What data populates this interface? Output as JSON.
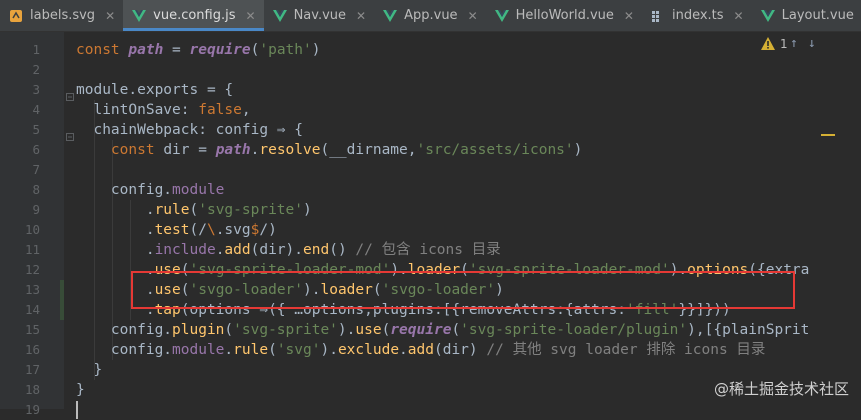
{
  "tabs": [
    {
      "label": "labels.svg",
      "icon": "svg-file-icon",
      "active": false
    },
    {
      "label": "vue.config.js",
      "icon": "vue-file-icon",
      "active": true
    },
    {
      "label": "Nav.vue",
      "icon": "vue-file-icon",
      "active": false
    },
    {
      "label": "App.vue",
      "icon": "vue-file-icon",
      "active": false
    },
    {
      "label": "HelloWorld.vue",
      "icon": "vue-file-icon",
      "active": false
    },
    {
      "label": "index.ts",
      "icon": "typescript-file-icon",
      "active": false
    },
    {
      "label": "Layout.vue",
      "icon": "vue-file-icon",
      "active": false
    }
  ],
  "overflow_icon": "nodejs-icon",
  "inspection": {
    "warning_count": "1",
    "up": "↑",
    "down": "↓"
  },
  "line_numbers": [
    "1",
    "2",
    "3",
    "4",
    "5",
    "6",
    "7",
    "8",
    "9",
    "10",
    "11",
    "12",
    "13",
    "14",
    "15",
    "16",
    "17",
    "18",
    "19"
  ],
  "code_lines": [
    [
      [
        "k",
        "const "
      ],
      [
        "v",
        "path"
      ],
      [
        "d",
        " = "
      ],
      [
        "v",
        "require"
      ],
      [
        "d",
        "("
      ],
      [
        "s",
        "'path'"
      ],
      [
        "d",
        ")"
      ]
    ],
    [],
    [
      [
        "d",
        "module.exports = {"
      ]
    ],
    [
      [
        "d",
        "  lintOnSave: "
      ],
      [
        "k",
        "false"
      ],
      [
        "d",
        ","
      ]
    ],
    [
      [
        "d",
        "  chainWebpack: config ⇒ {"
      ]
    ],
    [
      [
        "k",
        "    const "
      ],
      [
        "d",
        "dir = "
      ],
      [
        "v",
        "path"
      ],
      [
        "d",
        "."
      ],
      [
        "f",
        "resolve"
      ],
      [
        "d",
        "(__dirname,"
      ],
      [
        "s",
        "'src/assets/icons'"
      ],
      [
        "d",
        ")"
      ]
    ],
    [],
    [
      [
        "d",
        "    config."
      ],
      [
        "p",
        "module"
      ]
    ],
    [
      [
        "d",
        "        ."
      ],
      [
        "f",
        "rule"
      ],
      [
        "d",
        "("
      ],
      [
        "s",
        "'svg-sprite'"
      ],
      [
        "d",
        ")"
      ]
    ],
    [
      [
        "d",
        "        ."
      ],
      [
        "f",
        "test"
      ],
      [
        "d",
        "(/"
      ],
      [
        "k",
        "\\"
      ],
      [
        "d",
        ".svg"
      ],
      [
        "k",
        "$"
      ],
      [
        "d",
        "/)"
      ]
    ],
    [
      [
        "d",
        "        ."
      ],
      [
        "p",
        "include"
      ],
      [
        "d",
        "."
      ],
      [
        "f",
        "add"
      ],
      [
        "d",
        "(dir)."
      ],
      [
        "f",
        "end"
      ],
      [
        "d",
        "() "
      ],
      [
        "c",
        "// 包含 icons 目录"
      ]
    ],
    [
      [
        "d",
        "        ."
      ],
      [
        "f",
        "use"
      ],
      [
        "d",
        "("
      ],
      [
        "s",
        "'svg-sprite-loader-mod'"
      ],
      [
        "d",
        ")."
      ],
      [
        "f",
        "loader"
      ],
      [
        "d",
        "("
      ],
      [
        "s",
        "'svg-sprite-loader-mod'"
      ],
      [
        "d",
        ")."
      ],
      [
        "f",
        "options"
      ],
      [
        "d",
        "({extra"
      ]
    ],
    [
      [
        "d",
        "        ."
      ],
      [
        "f",
        "use"
      ],
      [
        "d",
        "("
      ],
      [
        "s",
        "'svgo-loader'"
      ],
      [
        "d",
        ")."
      ],
      [
        "f",
        "loader"
      ],
      [
        "d",
        "("
      ],
      [
        "s",
        "'svgo-loader'"
      ],
      [
        "d",
        ")"
      ]
    ],
    [
      [
        "d",
        "        ."
      ],
      [
        "f",
        "tap"
      ],
      [
        "d",
        "(options ⇒({ …options,plugins:[{removeAttrs:{attrs:"
      ],
      [
        "s",
        "'fill'"
      ],
      [
        "d",
        "}}]}))"
      ]
    ],
    [
      [
        "d",
        "    config."
      ],
      [
        "f",
        "plugin"
      ],
      [
        "d",
        "("
      ],
      [
        "s",
        "'svg-sprite'"
      ],
      [
        "d",
        ")."
      ],
      [
        "f",
        "use"
      ],
      [
        "d",
        "("
      ],
      [
        "v",
        "require"
      ],
      [
        "d",
        "("
      ],
      [
        "s",
        "'svg-sprite-loader/plugin'"
      ],
      [
        "d",
        "),[{plainSprit"
      ]
    ],
    [
      [
        "d",
        "    config."
      ],
      [
        "p",
        "module"
      ],
      [
        "d",
        "."
      ],
      [
        "f",
        "rule"
      ],
      [
        "d",
        "("
      ],
      [
        "s",
        "'svg'"
      ],
      [
        "d",
        ")."
      ],
      [
        "f",
        "exclude"
      ],
      [
        "d",
        "."
      ],
      [
        "f",
        "add"
      ],
      [
        "d",
        "(dir) "
      ],
      [
        "c",
        "// 其他 svg loader 排除 icons 目录"
      ]
    ],
    [
      [
        "d",
        "  }"
      ]
    ],
    [
      [
        "d",
        "}"
      ]
    ],
    []
  ],
  "watermark": "@稀土掘金技术社区",
  "colors": {
    "accent": "#4a88c7",
    "highlight_box": "#e53935",
    "warning": "#d5b034"
  }
}
